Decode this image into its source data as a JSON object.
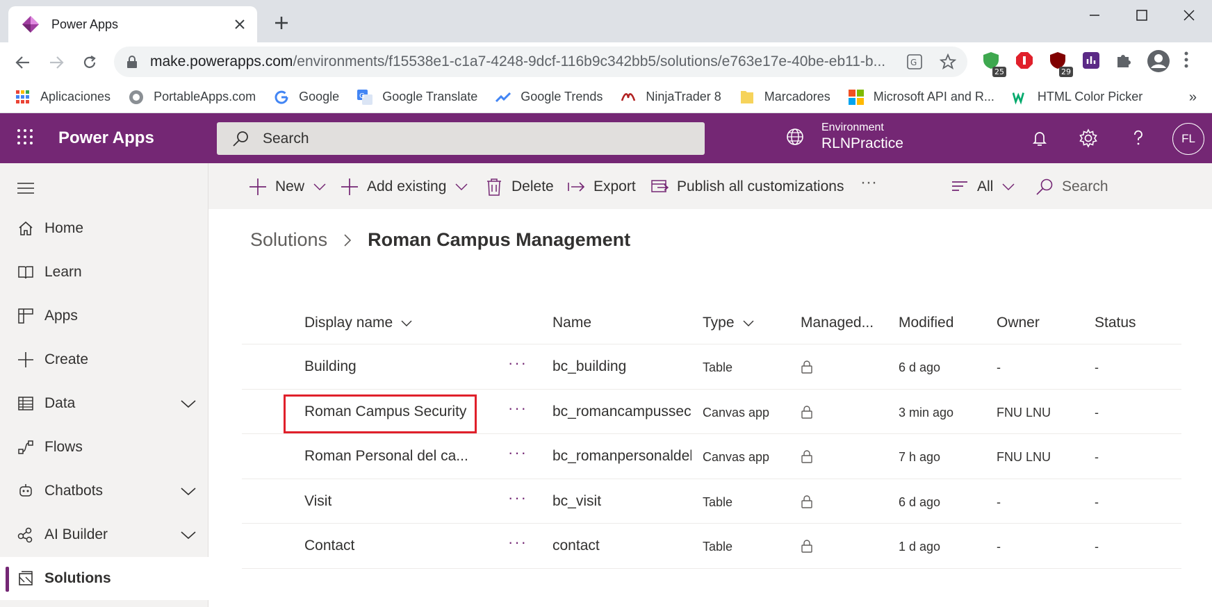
{
  "browser": {
    "tab_title": "Power Apps",
    "url_host": "make.powerapps.com",
    "url_path": "/environments/f15538e1-c1a7-4248-9dcf-116b9c342bb5/solutions/e763e17e-40be-eb11-b...",
    "ext_badge_1": "25",
    "ext_badge_2": "29",
    "bookmarks": [
      {
        "label": "Aplicaciones"
      },
      {
        "label": "PortableApps.com"
      },
      {
        "label": "Google"
      },
      {
        "label": "Google Translate"
      },
      {
        "label": "Google Trends"
      },
      {
        "label": "NinjaTrader 8"
      },
      {
        "label": "Marcadores"
      },
      {
        "label": "Microsoft API and R..."
      },
      {
        "label": "HTML Color Picker"
      }
    ],
    "more": "»"
  },
  "header": {
    "app_name": "Power Apps",
    "search_placeholder": "Search",
    "environment_label": "Environment",
    "environment_name": "RLNPractice",
    "avatar_initials": "FL"
  },
  "nav": {
    "items": [
      {
        "label": "Home"
      },
      {
        "label": "Learn"
      },
      {
        "label": "Apps"
      },
      {
        "label": "Create"
      },
      {
        "label": "Data"
      },
      {
        "label": "Flows"
      },
      {
        "label": "Chatbots"
      },
      {
        "label": "AI Builder"
      },
      {
        "label": "Solutions"
      }
    ]
  },
  "commands": {
    "new": "New",
    "add_existing": "Add existing",
    "delete": "Delete",
    "export": "Export",
    "publish": "Publish all customizations",
    "more": "···",
    "filter": "All",
    "search": "Search"
  },
  "breadcrumb": {
    "parent": "Solutions",
    "current": "Roman Campus Management"
  },
  "table": {
    "columns": [
      "Display name",
      "Name",
      "Type",
      "Managed...",
      "Modified",
      "Owner",
      "Status"
    ],
    "row_menu": "···",
    "rows": [
      {
        "display_name": "Building",
        "name": "bc_building",
        "type": "Table",
        "modified": "6 d ago",
        "owner": "-",
        "status": "-"
      },
      {
        "display_name": "Roman Campus Security",
        "name": "bc_romancampussecu",
        "type": "Canvas app",
        "modified": "3 min ago",
        "owner": "FNU LNU",
        "status": "-"
      },
      {
        "display_name": "Roman Personal del ca...",
        "name": "bc_romanpersonaldel",
        "type": "Canvas app",
        "modified": "7 h ago",
        "owner": "FNU LNU",
        "status": "-"
      },
      {
        "display_name": "Visit",
        "name": "bc_visit",
        "type": "Table",
        "modified": "6 d ago",
        "owner": "-",
        "status": "-"
      },
      {
        "display_name": "Contact",
        "name": "contact",
        "type": "Table",
        "modified": "1 d ago",
        "owner": "-",
        "status": "-"
      }
    ]
  },
  "colors": {
    "brand": "#742774",
    "highlight": "#e0202b"
  }
}
